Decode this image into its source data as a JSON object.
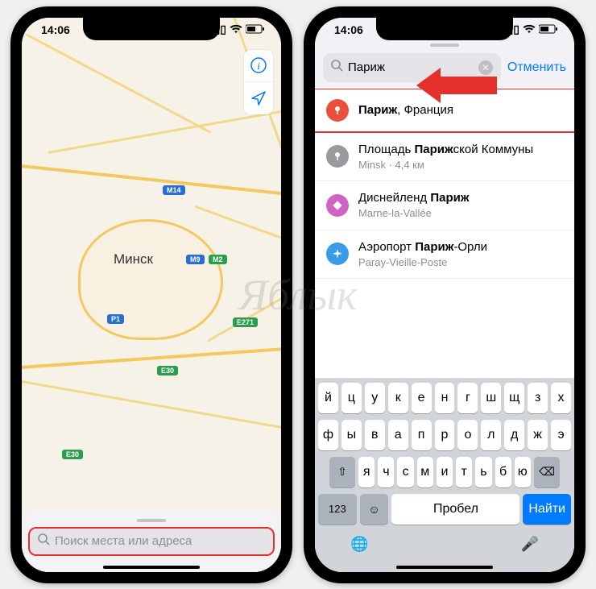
{
  "watermark": "Яблык",
  "status": {
    "time": "14:06"
  },
  "left": {
    "city": "Минск",
    "search_placeholder": "Поиск места или адреса",
    "badges": {
      "m14": "M14",
      "m9": "M9",
      "m2": "M2",
      "p1": "P1",
      "e271": "E271",
      "e30": "E30",
      "e30b": "E30"
    }
  },
  "right": {
    "query": "Париж",
    "cancel": "Отменить",
    "results": [
      {
        "icon_bg": "#e94f3a",
        "glyph": "📍",
        "title_prefix": "Париж",
        "title_suffix": ", Франция",
        "sub": ""
      },
      {
        "icon_bg": "#9a9a9e",
        "glyph": "📍",
        "title_prefix": "Площадь ",
        "title_bold": "Париж",
        "title_suffix2": "ской Коммуны",
        "sub": "Minsk · 4,4 км"
      },
      {
        "icon_bg": "#d063c3",
        "glyph": "◆",
        "title_prefix2": "Диснейленд ",
        "title_bold2": "Париж",
        "sub": "Marne-la-Vallée"
      },
      {
        "icon_bg": "#3a9be9",
        "glyph": "✈",
        "title_prefix3": "Аэропорт ",
        "title_bold3": "Париж",
        "title_suffix3": "-Орли",
        "sub": "Paray-Vieille-Poste"
      }
    ],
    "keyboard": {
      "row1": [
        "й",
        "ц",
        "у",
        "к",
        "е",
        "н",
        "г",
        "ш",
        "щ",
        "з",
        "х"
      ],
      "row2": [
        "ф",
        "ы",
        "в",
        "а",
        "п",
        "р",
        "о",
        "л",
        "д",
        "ж",
        "э"
      ],
      "row3": [
        "я",
        "ч",
        "с",
        "м",
        "и",
        "т",
        "ь",
        "б",
        "ю"
      ],
      "shift": "⇧",
      "backspace": "⌫",
      "numkey": "123",
      "emoji": "☺",
      "space": "Пробел",
      "find": "Найти",
      "globe": "🌐",
      "mic": "🎤"
    }
  }
}
